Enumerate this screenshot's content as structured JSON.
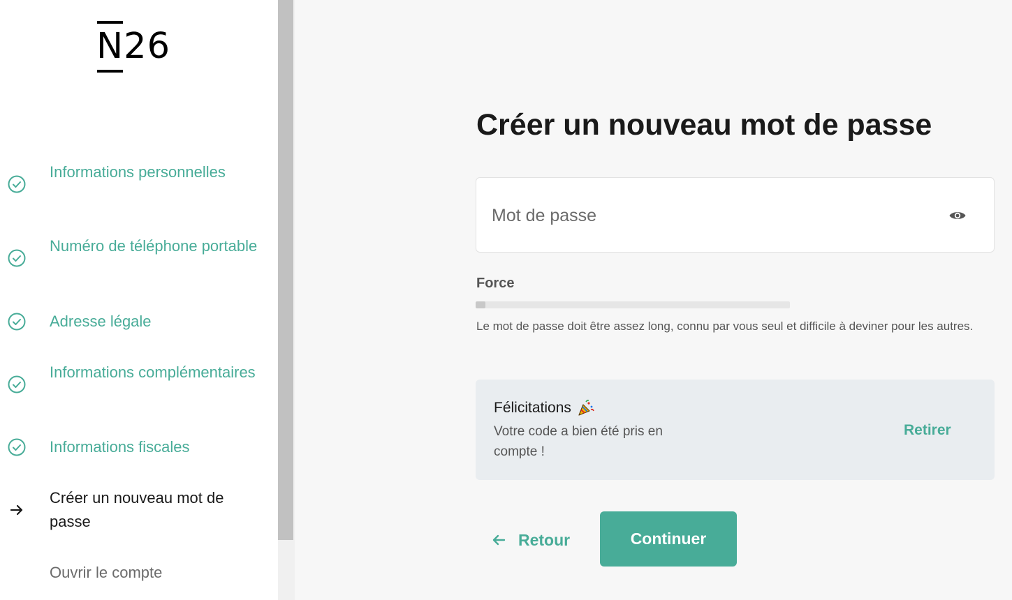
{
  "brand": {
    "logo_letter": "N",
    "logo_number": "26"
  },
  "sidebar": {
    "steps": [
      {
        "label": "Informations personnelles",
        "status": "done",
        "icon": "check-circle-icon"
      },
      {
        "label": "Numéro de téléphone portable",
        "status": "done",
        "icon": "check-circle-icon"
      },
      {
        "label": "Adresse légale",
        "status": "done",
        "icon": "check-circle-icon"
      },
      {
        "label": "Informations complémentaires",
        "status": "done",
        "icon": "check-circle-icon"
      },
      {
        "label": "Informations fiscales",
        "status": "done",
        "icon": "check-circle-icon"
      },
      {
        "label": "Créer un nouveau mot de passe",
        "status": "current",
        "icon": "arrow-right-icon"
      },
      {
        "label": "Ouvrir le compte",
        "status": "todo",
        "icon": ""
      }
    ]
  },
  "main": {
    "title": "Créer un nouveau mot de passe",
    "password": {
      "placeholder": "Mot de passe",
      "value": "",
      "visibility_icon": "eye-icon"
    },
    "strength": {
      "label": "Force",
      "level": 0.03
    },
    "help_text": "Le mot de passe doit être assez long, connu par vous seul et difficile à deviner pour les autres.",
    "promo": {
      "title": "Félicitations",
      "emoji_icon": "party-popper-icon",
      "text": "Votre code a bien été pris en compte !",
      "remove_label": "Retirer"
    },
    "back_label": "Retour",
    "continue_label": "Continuer"
  },
  "colors": {
    "accent": "#48ac98",
    "text_dark": "#1a1a1a",
    "text_muted": "#6b6b6b",
    "page_bg": "#f7f7f7",
    "promo_bg": "#e9edf0"
  }
}
